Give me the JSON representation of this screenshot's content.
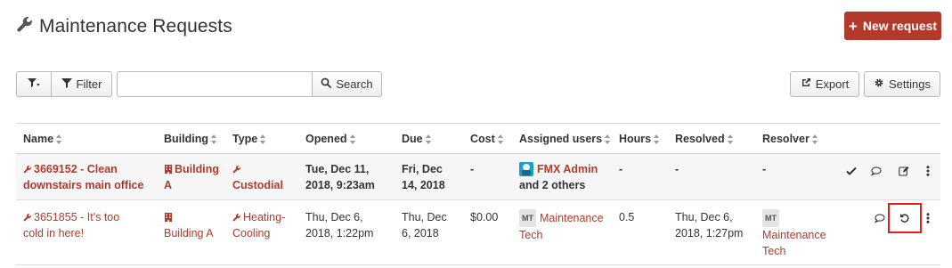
{
  "header": {
    "title": "Maintenance Requests",
    "new_button_label": "New request",
    "accent": "#b33a2b"
  },
  "toolbar": {
    "filter_label": "Filter",
    "search_value": "",
    "search_label": "Search",
    "export_label": "Export",
    "settings_label": "Settings"
  },
  "table": {
    "columns": [
      "Name",
      "Building",
      "Type",
      "Opened",
      "Due",
      "Cost",
      "Assigned users",
      "Hours",
      "Resolved",
      "Resolver"
    ],
    "rows": [
      {
        "name_line1": "3669152 - Clean",
        "name_line2": "downstairs main office",
        "building_line1": "Building",
        "building_line2": "A",
        "type_line1": "Custodial",
        "opened_line1": "Tue, Dec 11,",
        "opened_line2": "2018, 9:23am",
        "due_line1": "Fri, Dec",
        "due_line2": "14, 2018",
        "cost": "-",
        "assigned_line1": "FMX Admin",
        "assigned_line2": "and 2 others",
        "hours": "-",
        "resolved": "-",
        "resolver": "-"
      },
      {
        "name_line1": "3651855 - It's too",
        "name_line2": "cold in here!",
        "building_line1": "Building A",
        "type_line1": "Heating-",
        "type_line2": "Cooling",
        "opened_line1": "Thu, Dec 6,",
        "opened_line2": "2018, 1:22pm",
        "due_line1": "Thu, Dec",
        "due_line2": "6, 2018",
        "cost": "$0.00",
        "assigned_badge": "MT",
        "assigned_line1": "Maintenance",
        "assigned_line2": "Tech",
        "hours": "0.5",
        "resolved_line1": "Thu, Dec 6,",
        "resolved_line2": "2018, 1:27pm",
        "resolver_badge": "MT",
        "resolver_line1": "Maintenance",
        "resolver_line2": "Tech"
      }
    ]
  }
}
